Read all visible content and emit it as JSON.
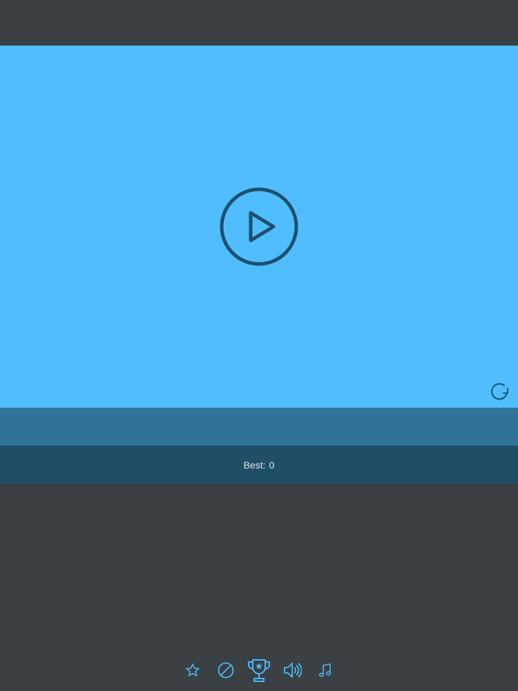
{
  "game": {
    "best_label": "Best:",
    "best_value": "0"
  },
  "icons": {
    "play": "play-icon",
    "restart": "restart-icon",
    "toolbar": [
      "star-icon",
      "no-ads-icon",
      "trophy-icon",
      "sound-icon",
      "music-icon"
    ]
  },
  "colors": {
    "background": "#3a4043",
    "game_area": "#4fbdfe",
    "band_mid": "#2f7399",
    "band_score": "#1f4e67",
    "icon_dark": "#1d4f6d",
    "toolbar_icon": "#4fb8f5"
  }
}
